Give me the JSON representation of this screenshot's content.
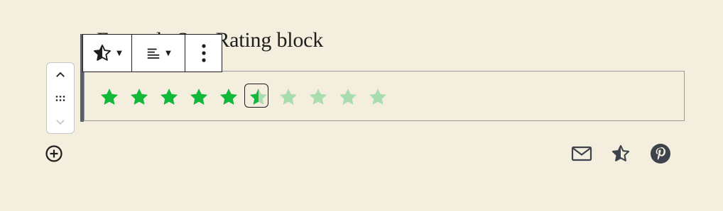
{
  "heading": "Example Star Rating block",
  "rating": {
    "value": 5.5,
    "max": 10
  },
  "colors": {
    "star_filled": "#11b83a",
    "star_empty": "#a9ddb0",
    "toolbar_border": "#1e1e1e",
    "icon": "#3c434a"
  },
  "toolbar": {
    "block_icon": "star-half-icon",
    "align_icon": "align-left-icon",
    "more_icon": "more-vertical-icon"
  },
  "mover": {
    "up_icon": "chevron-up-icon",
    "drag_icon": "drag-handle-icon",
    "down_icon": "chevron-down-icon"
  },
  "inserter_icon": "plus-circle-icon",
  "share_icons": [
    "mail-icon",
    "star-half-icon",
    "pinterest-icon"
  ]
}
